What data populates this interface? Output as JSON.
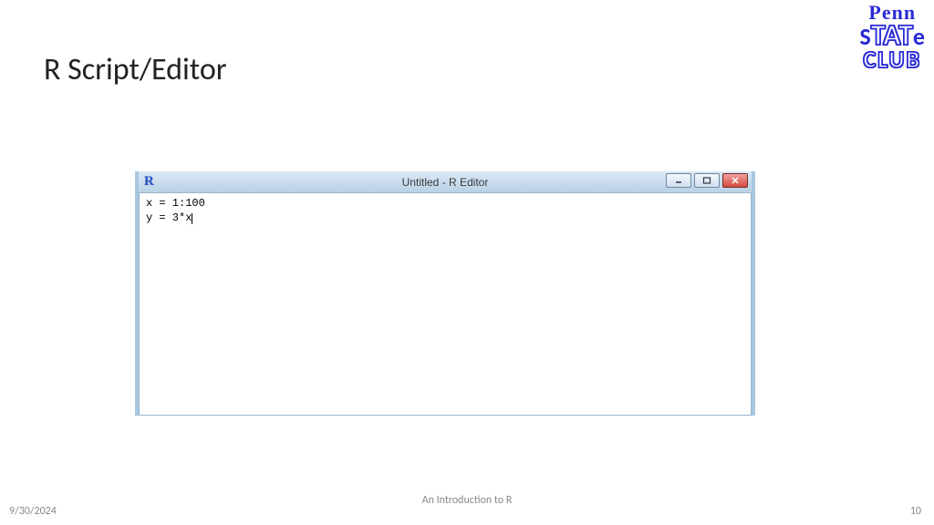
{
  "slide": {
    "title": "R Script/Editor"
  },
  "logo": {
    "line1": "Penn",
    "line2_pre": "S",
    "line2_mid": "TAT",
    "line2_post": "e",
    "line3": "CLUB"
  },
  "editor": {
    "window_title": "Untitled - R Editor",
    "app_icon_letter": "R",
    "code_line1": "x = 1:100",
    "code_line2": "y = 3*x"
  },
  "footer": {
    "date": "9/30/2024",
    "center": "An Introduction to R",
    "page": "10"
  }
}
